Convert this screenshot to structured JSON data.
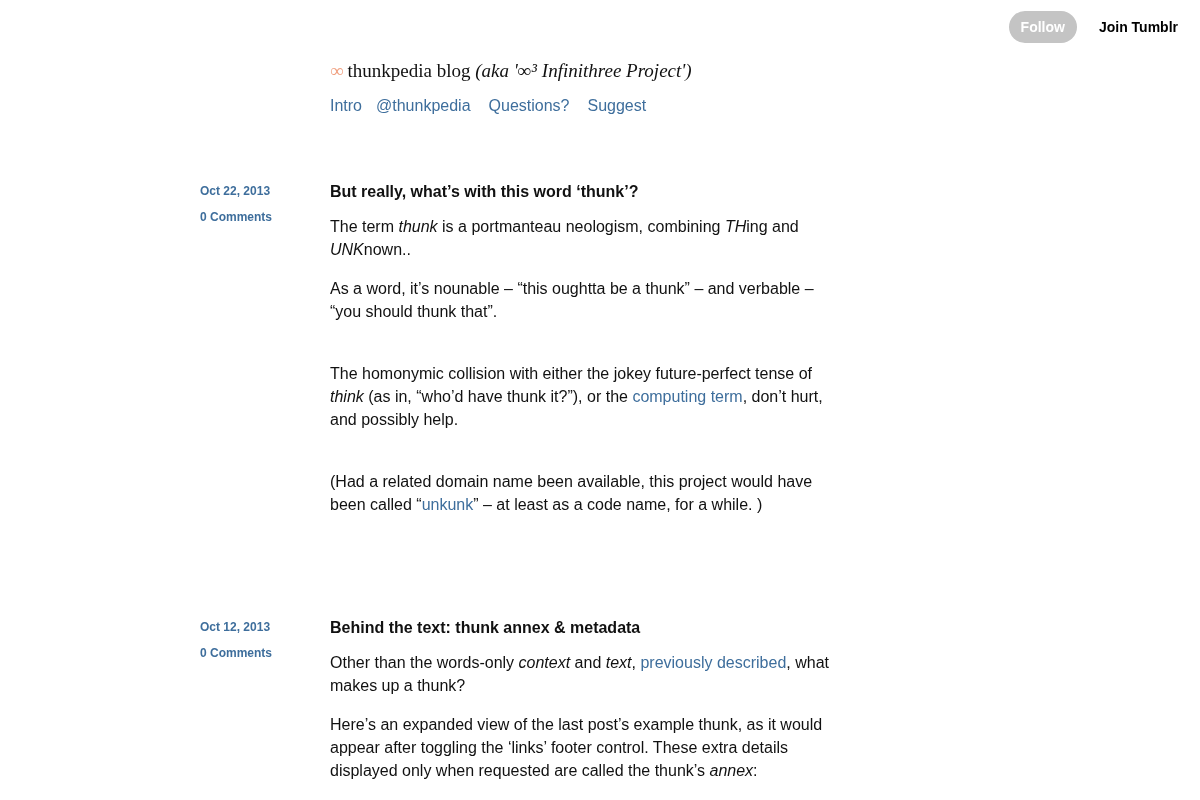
{
  "topbar": {
    "follow_button": "Follow",
    "join_link": "Join Tumblr"
  },
  "blog": {
    "mark": "∞",
    "title": "thunkpedia blog *(aka '∞³ Infinithree Project')*"
  },
  "nav": [
    "Intro",
    "@thunkpedia",
    "Questions?",
    "Suggest"
  ],
  "posts": [
    {
      "date": "Oct 22, 2013",
      "comments": "0 Comments",
      "title": "But really, what’s with this word ‘thunk’?",
      "paragraphs": [
        {
          "kind": "normal",
          "parts": [
            {
              "kind": "text",
              "text": "The term "
            },
            {
              "kind": "italic",
              "text": "thunk"
            },
            {
              "kind": "text",
              "text": " is a portmanteau neologism, combining "
            },
            {
              "kind": "italic",
              "text": "TH"
            },
            {
              "kind": "text",
              "text": "ing and "
            },
            {
              "kind": "italic",
              "text": "UNK"
            },
            {
              "kind": "text",
              "text": "nown.."
            }
          ]
        },
        {
          "kind": "normal",
          "parts": [
            {
              "kind": "text",
              "text": "As a word, it’s nounable – “this oughtta be a thunk” – and verbable – “you should thunk that”."
            }
          ]
        },
        {
          "kind": "spaced",
          "parts": [
            {
              "kind": "text",
              "text": "The homonymic collision with either the jokey future-perfect tense of *think* (as in, “who’d have thunk it?”), or the "
            },
            {
              "kind": "link",
              "text": "computing term"
            },
            {
              "kind": "text",
              "text": ", don’t hurt, and possibly help."
            }
          ]
        },
        {
          "kind": "spaced",
          "parts": [
            {
              "kind": "text",
              "text": "(Had a related domain name been available, this project would have been called “"
            },
            {
              "kind": "link",
              "text": "unkunk"
            },
            {
              "kind": "text",
              "text": "” – at least as a code name, for a while. )"
            }
          ]
        }
      ]
    },
    {
      "date": "Oct 12, 2013",
      "comments": "0 Comments",
      "title": "Behind the text: thunk annex & metadata",
      "paragraphs": [
        {
          "kind": "normal",
          "parts": [
            {
              "kind": "text",
              "text": "Other than the words-only *context* and *text*, "
            },
            {
              "kind": "link",
              "text": "previously described"
            },
            {
              "kind": "text",
              "text": ", what makes up a thunk?"
            }
          ]
        },
        {
          "kind": "normal",
          "parts": [
            {
              "kind": "text",
              "text": "Here’s an expanded view of the last post’s example thunk, as it would appear after toggling the ‘links’ footer control. These extra details displayed only when requested are called the thunk’s *annex*:"
            }
          ]
        }
      ]
    }
  ]
}
